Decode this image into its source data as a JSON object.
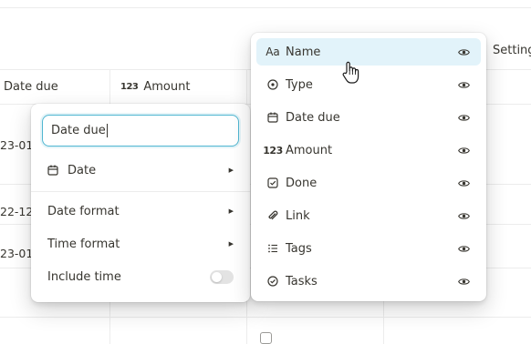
{
  "table": {
    "columns": [
      {
        "label": "Date due",
        "icon": "calendar-icon"
      },
      {
        "label": "Amount",
        "icon": "number-icon",
        "glyph": "123"
      }
    ],
    "settings_label": "Setting",
    "partial_cells": [
      "23-01-",
      "22-12-",
      "23-01-"
    ]
  },
  "property_editor": {
    "name_value": "Date due",
    "type_label": "Date",
    "type_icon": "calendar-icon",
    "options": [
      {
        "label": "Date format",
        "control": "submenu"
      },
      {
        "label": "Time format",
        "control": "submenu"
      },
      {
        "label": "Include time",
        "control": "toggle",
        "value": false
      }
    ]
  },
  "properties_menu": {
    "items": [
      {
        "label": "Name",
        "icon": "text-aa-icon",
        "glyph": "Aa",
        "visible": true,
        "hovered": true
      },
      {
        "label": "Type",
        "icon": "select-circle-icon",
        "visible": true
      },
      {
        "label": "Date due",
        "icon": "calendar-icon",
        "visible": true
      },
      {
        "label": "Amount",
        "icon": "number-icon",
        "glyph": "123",
        "visible": true
      },
      {
        "label": "Done",
        "icon": "checkbox-icon",
        "visible": true
      },
      {
        "label": "Link",
        "icon": "paperclip-icon",
        "visible": true
      },
      {
        "label": "Tags",
        "icon": "list-icon",
        "visible": true
      },
      {
        "label": "Tasks",
        "icon": "check-circle-icon",
        "visible": true
      }
    ]
  },
  "colors": {
    "hover_bg": "#e2f3fa",
    "input_focus": "#4fb6d1",
    "checkbox_accent": "#2383e2"
  }
}
